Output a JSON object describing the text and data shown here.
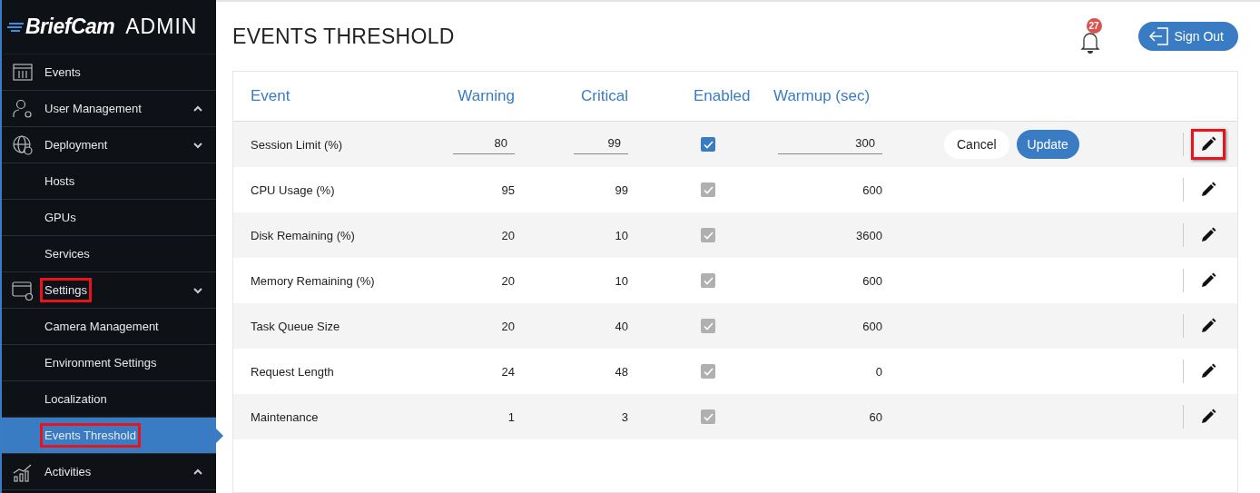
{
  "brand": {
    "logo": "BriefCam",
    "suffix": "ADMIN"
  },
  "sidebar": {
    "items": [
      {
        "kind": "section",
        "label": "Events",
        "selected": false,
        "highlighted": false
      },
      {
        "kind": "section",
        "label": "User Management",
        "expanded": false,
        "selected": false,
        "highlighted": false
      },
      {
        "kind": "section",
        "label": "Deployment",
        "expanded": true,
        "selected": false,
        "highlighted": false
      },
      {
        "kind": "sub",
        "label": "Hosts",
        "selected": false,
        "highlighted": false
      },
      {
        "kind": "sub",
        "label": "GPUs",
        "selected": false,
        "highlighted": false
      },
      {
        "kind": "sub",
        "label": "Services",
        "selected": false,
        "highlighted": false
      },
      {
        "kind": "section",
        "label": "Settings",
        "expanded": true,
        "selected": false,
        "highlighted": true
      },
      {
        "kind": "sub",
        "label": "Camera Management",
        "selected": false,
        "highlighted": false
      },
      {
        "kind": "sub",
        "label": "Environment Settings",
        "selected": false,
        "highlighted": false
      },
      {
        "kind": "sub",
        "label": "Localization",
        "selected": false,
        "highlighted": false
      },
      {
        "kind": "sub",
        "label": "Events Threshold",
        "selected": true,
        "highlighted": true
      },
      {
        "kind": "section",
        "label": "Activities",
        "expanded": false,
        "selected": false,
        "highlighted": false
      }
    ]
  },
  "header": {
    "title": "EVENTS THRESHOLD",
    "notifications": "27",
    "sign_out": "Sign Out"
  },
  "table": {
    "columns": [
      "Event",
      "Warning",
      "Critical",
      "Enabled",
      "Warmup (sec)"
    ],
    "rows": [
      {
        "kind": "editing",
        "event": "Session Limit (%)",
        "warning": "80",
        "critical": "99",
        "enabled": true,
        "warmup": "300",
        "cancel": "Cancel",
        "update": "Update",
        "edit_highlighted": true
      },
      {
        "kind": "view",
        "event": "CPU Usage (%)",
        "warning": "95",
        "critical": "99",
        "enabled": true,
        "warmup": "600",
        "edit_highlighted": false
      },
      {
        "kind": "view",
        "event": "Disk Remaining (%)",
        "warning": "20",
        "critical": "10",
        "enabled": true,
        "warmup": "3600",
        "edit_highlighted": false
      },
      {
        "kind": "view",
        "event": "Memory Remaining (%)",
        "warning": "20",
        "critical": "10",
        "enabled": true,
        "warmup": "600",
        "edit_highlighted": false
      },
      {
        "kind": "view",
        "event": "Task Queue Size",
        "warning": "20",
        "critical": "40",
        "enabled": true,
        "warmup": "600",
        "edit_highlighted": false
      },
      {
        "kind": "view",
        "event": "Request Length",
        "warning": "24",
        "critical": "48",
        "enabled": true,
        "warmup": "0",
        "edit_highlighted": false
      },
      {
        "kind": "view",
        "event": "Maintenance",
        "warning": "1",
        "critical": "3",
        "enabled": true,
        "warmup": "60",
        "edit_highlighted": false
      }
    ]
  }
}
